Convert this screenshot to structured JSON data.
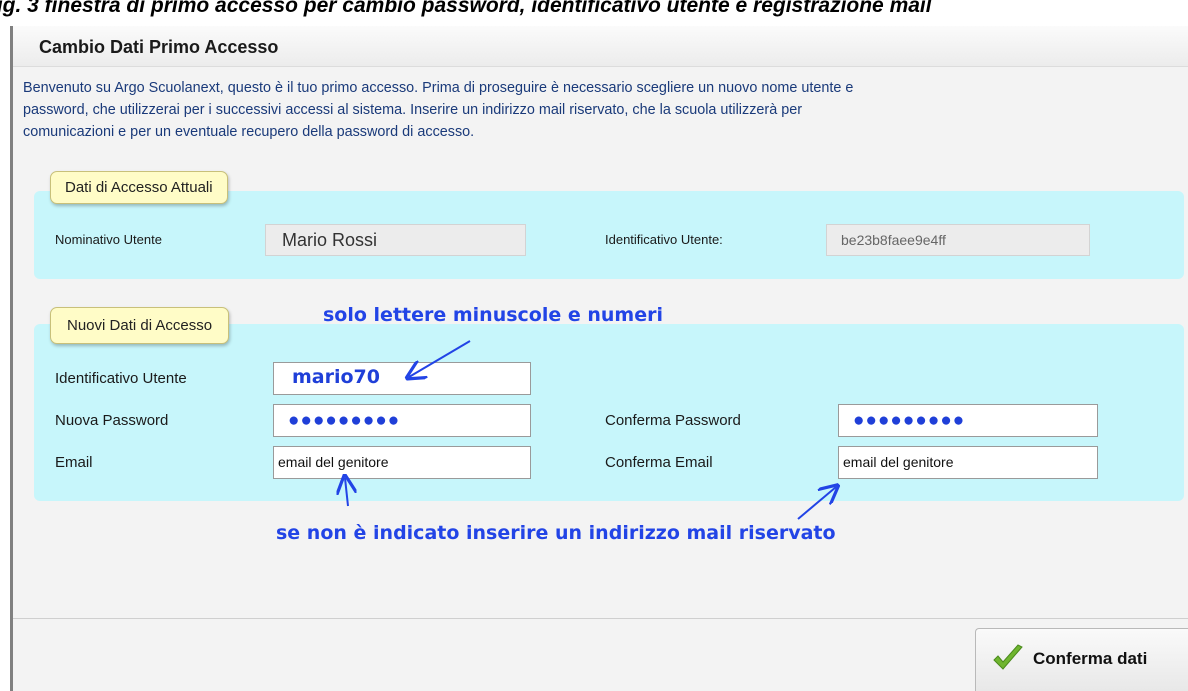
{
  "caption": "Fig. 3 finestra di primo accesso per cambio password, identificativo utente e registrazione mail",
  "window": {
    "title": "Cambio Dati Primo Accesso",
    "intro_lines": [
      "Benvenuto su Argo Scuolanext, questo è il tuo primo accesso. Prima di proseguire è necessario scegliere un nuovo nome utente e",
      "password, che utilizzerai per i successivi accessi al sistema. Inserire un indirizzo mail riservato, che la scuola utilizzerà per",
      "comunicazioni e per un eventuale recupero della password di accesso."
    ]
  },
  "current_access": {
    "legend": "Dati di Accesso Attuali",
    "name_label": "Nominativo Utente",
    "name_value": "Mario Rossi",
    "id_label": "Identificativo Utente:",
    "id_value": "be23b8faee9e4ff"
  },
  "new_access": {
    "legend": "Nuovi Dati di Accesso",
    "username_label": "Identificativo Utente",
    "username_value": "mario70",
    "password_label": "Nuova Password",
    "password_value": "●●●●●●●●●",
    "confirm_password_label": "Conferma Password",
    "confirm_password_value": "●●●●●●●●●",
    "email_label": "Email",
    "email_value": "email del genitore",
    "confirm_email_label": "Conferma Email",
    "confirm_email_value": "email del genitore"
  },
  "annotations": {
    "top": "solo lettere minuscole e numeri",
    "bottom": "se non è indicato inserire un indirizzo mail riservato"
  },
  "footer": {
    "confirm_label": "Conferma dati"
  },
  "colors": {
    "panel_bg": "#c7f6fb",
    "legend_bg": "#fffcc7",
    "annotation": "#2244e6",
    "intro_text": "#1a3a7a"
  }
}
